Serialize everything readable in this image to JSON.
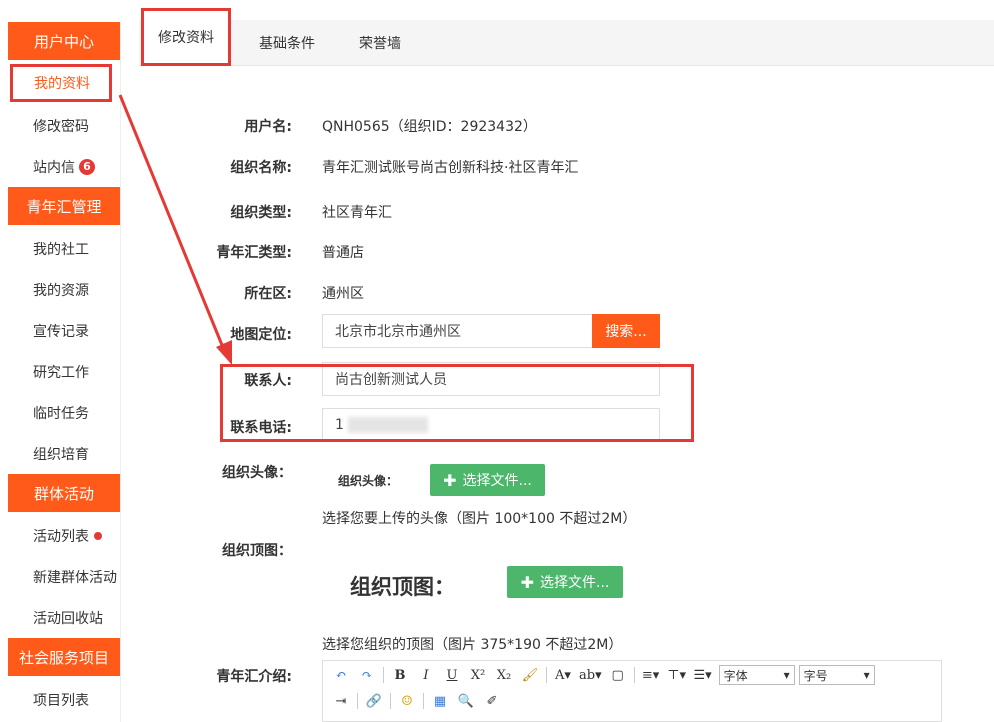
{
  "sidebar": {
    "groups": [
      {
        "title": "用户中心",
        "items": [
          {
            "label": "我的资料",
            "active": true
          },
          {
            "label": "修改密码"
          },
          {
            "label": "站内信",
            "badge": "6"
          }
        ]
      },
      {
        "title": "青年汇管理",
        "items": [
          {
            "label": "我的社工"
          },
          {
            "label": "我的资源"
          },
          {
            "label": "宣传记录"
          },
          {
            "label": "研究工作"
          },
          {
            "label": "临时任务"
          },
          {
            "label": "组织培育"
          }
        ]
      },
      {
        "title": "群体活动",
        "items": [
          {
            "label": "活动列表",
            "dot": true
          },
          {
            "label": "新建群体活动"
          },
          {
            "label": "活动回收站"
          }
        ]
      },
      {
        "title": "社会服务项目",
        "items": [
          {
            "label": "项目列表"
          }
        ]
      }
    ]
  },
  "tabs": [
    "修改资料",
    "基础条件",
    "荣誉墙"
  ],
  "form": {
    "username_label": "用户名:",
    "username_value": "QNH0565（组织ID：2923432）",
    "org_name_label": "组织名称:",
    "org_name_value": "青年汇测试账号尚古创新科技·社区青年汇",
    "org_type_label": "组织类型:",
    "org_type_value": "社区青年汇",
    "qnh_type_label": "青年汇类型:",
    "qnh_type_value": "普通店",
    "district_label": "所在区:",
    "district_value": "通州区",
    "map_label": "地图定位:",
    "map_value": "北京市北京市通州区",
    "search_button": "搜索...",
    "contact_label": "联系人:",
    "contact_value": "尚古创新测试人员",
    "phone_label": "联系电话:",
    "phone_value": "1",
    "avatar_label": "组织头像：",
    "avatar_inner_label": "组织头像：",
    "choose_file": "选择文件...",
    "avatar_hint": "选择您要上传的头像（图片 100*100 不超过2M）",
    "cover_label": "组织顶图：",
    "cover_inner_label": "组织顶图：",
    "cover_hint": "选择您组织的顶图（图片 375*190 不超过2M）",
    "intro_label": "青年汇介绍:"
  },
  "editor": {
    "font_select": "字体",
    "size_select": "字号"
  }
}
